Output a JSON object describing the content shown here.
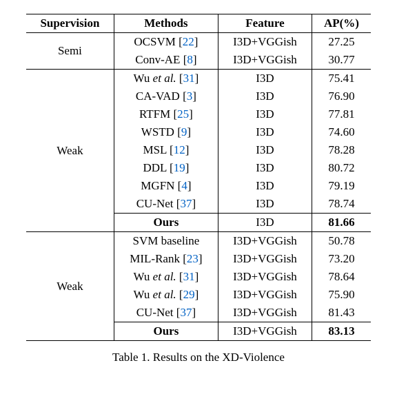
{
  "header": {
    "supervision": "Supervision",
    "methods": "Methods",
    "feature": "Feature",
    "ap": "AP(%)"
  },
  "sec1": {
    "sup": "Semi",
    "rows": [
      {
        "method_pre": "OCSVM [",
        "cite": "22",
        "method_post": "]",
        "feature": "I3D+VGGish",
        "ap": "27.25"
      },
      {
        "method_pre": "Conv-AE  [",
        "cite": "8",
        "method_post": "]",
        "feature": "I3D+VGGish",
        "ap": "30.77"
      }
    ]
  },
  "sec2": {
    "sup": "Weak",
    "rows": [
      {
        "method_pre": "Wu ",
        "ital": "et al.",
        "method_mid": " [",
        "cite": "31",
        "method_post": "]",
        "feature": "I3D",
        "ap": "75.41"
      },
      {
        "method_pre": "CA-VAD [",
        "cite": "3",
        "method_post": "]",
        "feature": "I3D",
        "ap": "76.90"
      },
      {
        "method_pre": "RTFM [",
        "cite": "25",
        "method_post": "]",
        "feature": "I3D",
        "ap": "77.81"
      },
      {
        "method_pre": "WSTD [",
        "cite": "9",
        "method_post": "]",
        "feature": "I3D",
        "ap": "74.60"
      },
      {
        "method_pre": "MSL [",
        "cite": "12",
        "method_post": "]",
        "feature": "I3D",
        "ap": "78.28"
      },
      {
        "method_pre": "DDL [",
        "cite": "19",
        "method_post": "]",
        "feature": "I3D",
        "ap": "80.72"
      },
      {
        "method_pre": "MGFN [",
        "cite": "4",
        "method_post": "]",
        "feature": "I3D",
        "ap": "79.19"
      },
      {
        "method_pre": "CU-Net [",
        "cite": "37",
        "method_post": "]",
        "feature": "I3D",
        "ap": "78.74"
      }
    ],
    "ours": {
      "method": "Ours",
      "feature": "I3D",
      "ap": "81.66"
    }
  },
  "sec3": {
    "sup": "Weak",
    "rows": [
      {
        "method_pre": "SVM baseline",
        "feature": "I3D+VGGish",
        "ap": "50.78"
      },
      {
        "method_pre": "MIL-Rank [",
        "cite": "23",
        "method_post": "]",
        "feature": "I3D+VGGish",
        "ap": "73.20"
      },
      {
        "method_pre": "Wu ",
        "ital": "et al.",
        "method_mid": " [",
        "cite": "31",
        "method_post": "]",
        "feature": "I3D+VGGish",
        "ap": "78.64"
      },
      {
        "method_pre": "Wu ",
        "ital": "et al.",
        "method_mid": " [",
        "cite": "29",
        "method_post": "]",
        "feature": "I3D+VGGish",
        "ap": "75.90"
      },
      {
        "method_pre": "CU-Net [",
        "cite": "37",
        "method_post": "]",
        "feature": "I3D+VGGish",
        "ap": "81.43"
      }
    ],
    "ours": {
      "method": "Ours",
      "feature": "I3D+VGGish",
      "ap": "83.13"
    }
  },
  "caption_pre": "Table 1. Results on the XD-Violence"
}
